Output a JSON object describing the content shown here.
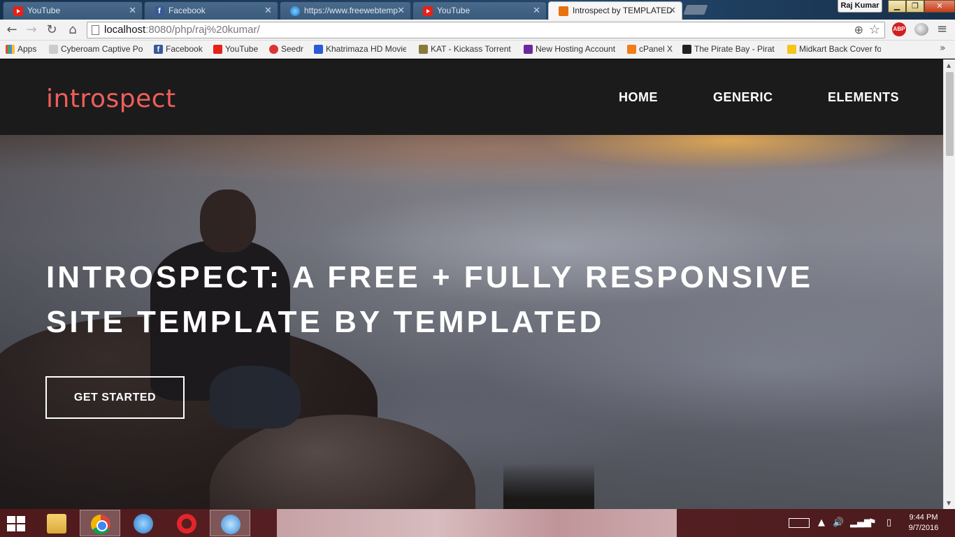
{
  "browser": {
    "tabs": [
      {
        "label": "YouTube",
        "favicon": "youtube-icon"
      },
      {
        "label": "Facebook",
        "favicon": "facebook-icon"
      },
      {
        "label": "https://www.freewebtemp",
        "favicon": "ie-icon"
      },
      {
        "label": "YouTube",
        "favicon": "youtube-icon"
      },
      {
        "label": "Introspect by TEMPLATED",
        "favicon": "templated-icon",
        "active": true
      }
    ],
    "user": "Raj Kumar",
    "address": {
      "host": "localhost",
      "path": ":8080/php/raj%20kumar/"
    },
    "extensions": {
      "abp": "ABP"
    },
    "bookmarks": [
      "Apps",
      "Cyberoam Captive Po",
      "Facebook",
      "YouTube",
      "Seedr",
      "Khatrimaza HD Movie",
      "KAT - Kickass Torrent",
      "New Hosting Account",
      "cPanel X",
      "The Pirate Bay - Pirat",
      "Midkart Back Cover fo"
    ]
  },
  "site": {
    "logo": "introspect",
    "nav": [
      "HOME",
      "GENERIC",
      "ELEMENTS"
    ],
    "hero": {
      "title_strong": "INTROSPECT:",
      "title_rest": " A FREE + FULLY RESPONSIVE SITE TEMPLATE BY TEMPLATED",
      "cta": "GET STARTED"
    }
  },
  "taskbar": {
    "time": "9:44 PM",
    "date": "9/7/2016"
  },
  "colors": {
    "logo": "#ef5e5c",
    "header_bg": "#1b1b1b",
    "taskbar": "#5a2226"
  }
}
